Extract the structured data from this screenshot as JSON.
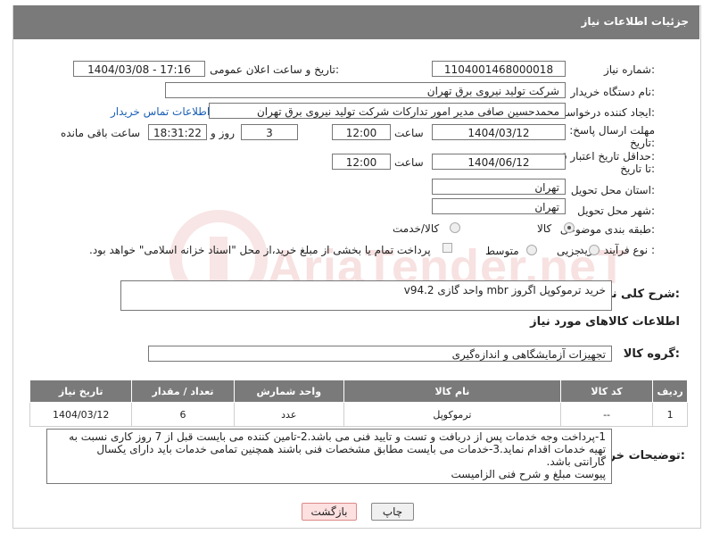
{
  "header": {
    "title": "جزئیات اطلاعات نیاز"
  },
  "form": {
    "need_number_label": "شماره نیاز:",
    "need_number": "1104001468000018",
    "announce_label": "تاریخ و ساعت اعلان عمومی:",
    "announce_value": "1404/03/08 - 17:16",
    "buyer_org_label": "نام دستگاه خریدار:",
    "buyer_org": "شرکت تولید نیروی برق تهران",
    "requester_label": "ایجاد کننده درخواست:",
    "requester": "محمدحسین صافی مدیر امور تدارکات شرکت تولید نیروی برق تهران",
    "buyer_contact_link": "اطلاعات تماس خریدار",
    "deadline_label_1": "مهلت ارسال پاسخ: تا",
    "deadline_label_2": "تاریخ:",
    "deadline_date": "1404/03/12",
    "time_label": "ساعت",
    "deadline_time": "12:00",
    "days_value": "3",
    "days_label": "روز و",
    "remaining_time": "18:31:22",
    "remaining_label": "ساعت باقی مانده",
    "validity_label_1": "حداقل تاریخ اعتبار قیمت:",
    "validity_label_2": "تا تاریخ:",
    "validity_date": "1404/06/12",
    "validity_time": "12:00",
    "province_label": "استان محل تحویل:",
    "province": "تهران",
    "city_label": "شهر محل تحویل:",
    "city": "تهران",
    "category_label": "طبقه بندی موضوعی:",
    "category_options": [
      "کالا",
      "کالا/خدمت"
    ],
    "category_selected": "کالا",
    "process_label": "نوع فرآیند خرید :",
    "process_options": [
      "جزیی",
      "متوسط"
    ],
    "process_note": "پرداخت تمام یا بخشی از مبلغ خرید،از محل \"اسناد خزانه اسلامی\" خواهد بود."
  },
  "description": {
    "label": "شرح کلی نیاز:",
    "value": "خرید ترموکوپل اگروز mbr واحد گازی v94.2"
  },
  "goods": {
    "section_title": "اطلاعات کالاهای مورد نیاز",
    "group_label": "گروه کالا:",
    "group_value": "تجهیزات آزمایشگاهی و اندازه‌گیری",
    "columns": [
      "ردیف",
      "کد کالا",
      "نام کالا",
      "واحد شمارش",
      "تعداد / مقدار",
      "تاریخ نیاز"
    ],
    "rows": [
      [
        "1",
        "--",
        "ترموکوپل",
        "عدد",
        "6",
        "1404/03/12"
      ]
    ]
  },
  "buyer_notes": {
    "label": "توضیحات خریدار:",
    "lines": [
      "1-پرداخت وجه خدمات پس از دریافت و تست و تایید فنی می باشد.2-تامین کننده می بایست قبل از 7 روز کاری نسبت به",
      "تهیه خدمات اقدام نماید.3-خدمات می بایست مطابق مشخصات فنی باشند همچنین تمامی خدمات باید دارای یکسال",
      "گارانتی باشد.",
      "پیوست مبلغ و شرح فنی الزامیست"
    ]
  },
  "buttons": {
    "print": "چاپ",
    "back": "بازگشت"
  },
  "watermark": {
    "text": "AriaTender.neT",
    "color": "#cc3333"
  }
}
